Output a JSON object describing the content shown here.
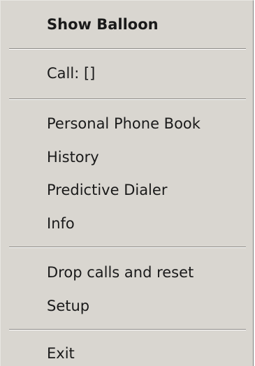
{
  "menu": {
    "show_balloon": "Show Balloon",
    "call": "Call: []",
    "personal_phone_book": "Personal Phone Book",
    "history": "History",
    "predictive_dialer": "Predictive Dialer",
    "info": "Info",
    "drop_calls_and_reset": "Drop calls and reset",
    "setup": "Setup",
    "exit": "Exit"
  },
  "colors": {
    "menu_background": "#d9d6d0",
    "separator_dark": "#8c8a86",
    "separator_light": "#ffffff",
    "text": "#1a1a1a"
  }
}
